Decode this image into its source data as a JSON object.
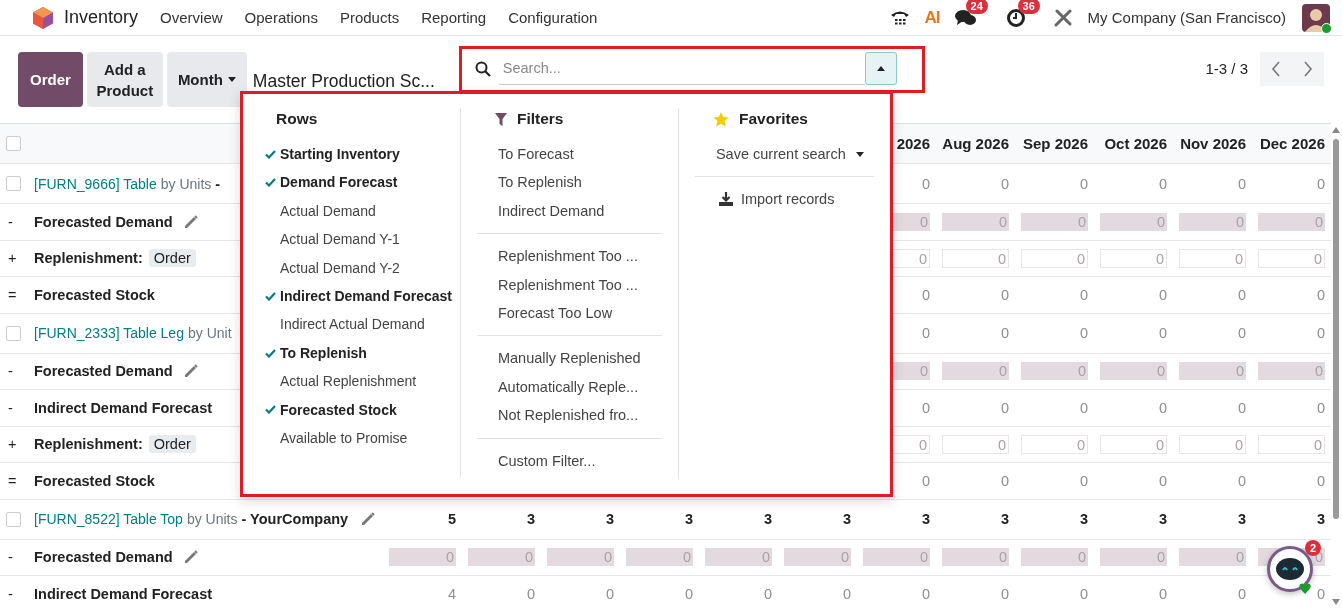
{
  "navbar": {
    "app": "Inventory",
    "menus": [
      "Overview",
      "Operations",
      "Products",
      "Reporting",
      "Configuration"
    ],
    "ai_label": "AI",
    "messages_badge": "24",
    "activities_badge": "36",
    "company": "My Company (San Francisco)"
  },
  "control_panel": {
    "buttons": [
      {
        "label": "Order",
        "kind": "primary"
      },
      {
        "label": "Add a Product",
        "kind": "secondary"
      },
      {
        "label": "Month",
        "kind": "dropdown"
      }
    ],
    "title": "Master Production Sc...",
    "search": {
      "placeholder": "Search...",
      "panel_open": true
    },
    "pager": "1-3 / 3"
  },
  "search_panel": {
    "rows": {
      "title": "Rows",
      "items": [
        {
          "label": "Starting Inventory",
          "checked": true
        },
        {
          "label": "Demand Forecast",
          "checked": true
        },
        {
          "label": "Actual Demand",
          "checked": false
        },
        {
          "label": "Actual Demand Y-1",
          "checked": false
        },
        {
          "label": "Actual Demand Y-2",
          "checked": false
        },
        {
          "label": "Indirect Demand Forecast",
          "checked": true
        },
        {
          "label": "Indirect Actual Demand",
          "checked": false
        },
        {
          "label": "To Replenish",
          "checked": true
        },
        {
          "label": "Actual Replenishment",
          "checked": false
        },
        {
          "label": "Forecasted Stock",
          "checked": true
        },
        {
          "label": "Available to Promise",
          "checked": false
        }
      ]
    },
    "filters": {
      "title": "Filters",
      "groups": [
        [
          "To Forecast",
          "To Replenish",
          "Indirect Demand"
        ],
        [
          "Replenishment Too ...",
          "Replenishment Too ...",
          "Forecast Too Low"
        ],
        [
          "Manually Replenished",
          "Automatically Reple...",
          "Not Replenished fro..."
        ],
        [
          "Custom Filter..."
        ]
      ]
    },
    "favorites": {
      "title": "Favorites",
      "save_label": "Save current search",
      "import_label": "Import records"
    }
  },
  "table": {
    "all_selected": false,
    "columns": [
      "2026",
      "Aug 2026",
      "Sep 2026",
      "Oct 2026",
      "Nov 2026",
      "Dec 2026"
    ],
    "rows": [
      {
        "kind": "product",
        "selected": false,
        "code": "[FURN_9666] Table",
        "unit": "by Units",
        "company": "-",
        "muted": true,
        "editable": false,
        "values": [
          "0",
          "0",
          "0",
          "0",
          "0",
          "0"
        ]
      },
      {
        "kind": "forecast",
        "sign": "-",
        "label": "Forecasted Demand",
        "values": [
          "0",
          "0",
          "0",
          "0",
          "0",
          "0"
        ]
      },
      {
        "kind": "replenish",
        "sign": "+",
        "label": "Replenishment:",
        "tag": "Order",
        "values": [
          "0",
          "0",
          "0",
          "0",
          "0",
          "0"
        ]
      },
      {
        "kind": "plain",
        "sign": "=",
        "label": "Forecasted Stock",
        "values": [
          "0",
          "0",
          "0",
          "0",
          "0",
          "0"
        ]
      },
      {
        "kind": "product",
        "selected": false,
        "code": "[FURN_2333] Table Leg",
        "unit": "by Unit",
        "muted": true,
        "editable": false,
        "values": [
          "0",
          "0",
          "0",
          "0",
          "0",
          "0"
        ]
      },
      {
        "kind": "forecast",
        "sign": "-",
        "label": "Forecasted Demand",
        "values": [
          "0",
          "0",
          "0",
          "0",
          "0",
          "0"
        ]
      },
      {
        "kind": "plain",
        "sign": "-",
        "label": "Indirect Demand Forecast",
        "values": [
          "0",
          "0",
          "0",
          "0",
          "0",
          "0"
        ]
      },
      {
        "kind": "replenish",
        "sign": "+",
        "label": "Replenishment:",
        "tag": "Order",
        "values": [
          "0",
          "0",
          "0",
          "0",
          "0",
          "0"
        ]
      },
      {
        "kind": "plain",
        "sign": "=",
        "label": "Forecasted Stock",
        "values": [
          "0",
          "0",
          "0",
          "0",
          "0",
          "0"
        ]
      },
      {
        "kind": "product",
        "selected": false,
        "code": "[FURN_8522] Table Top",
        "unit": "by Units",
        "company": "- YourCompany",
        "muted": false,
        "editable": true,
        "values": [
          "5",
          "3",
          "3",
          "3",
          "3",
          "3",
          "3",
          "3",
          "3",
          "3",
          "3",
          "3"
        ]
      },
      {
        "kind": "forecast",
        "sign": "-",
        "label": "Forecasted Demand",
        "values": [
          "0",
          "0",
          "0",
          "0",
          "0",
          "0",
          "0",
          "0",
          "0",
          "0",
          "0",
          "0"
        ]
      },
      {
        "kind": "plain",
        "sign": "-",
        "label": "Indirect Demand Forecast",
        "values": [
          "4",
          "0",
          "0",
          "0",
          "0",
          "0",
          "0",
          "0",
          "0",
          "0",
          "0",
          "0"
        ]
      }
    ]
  },
  "chat": {
    "badge": "2"
  }
}
